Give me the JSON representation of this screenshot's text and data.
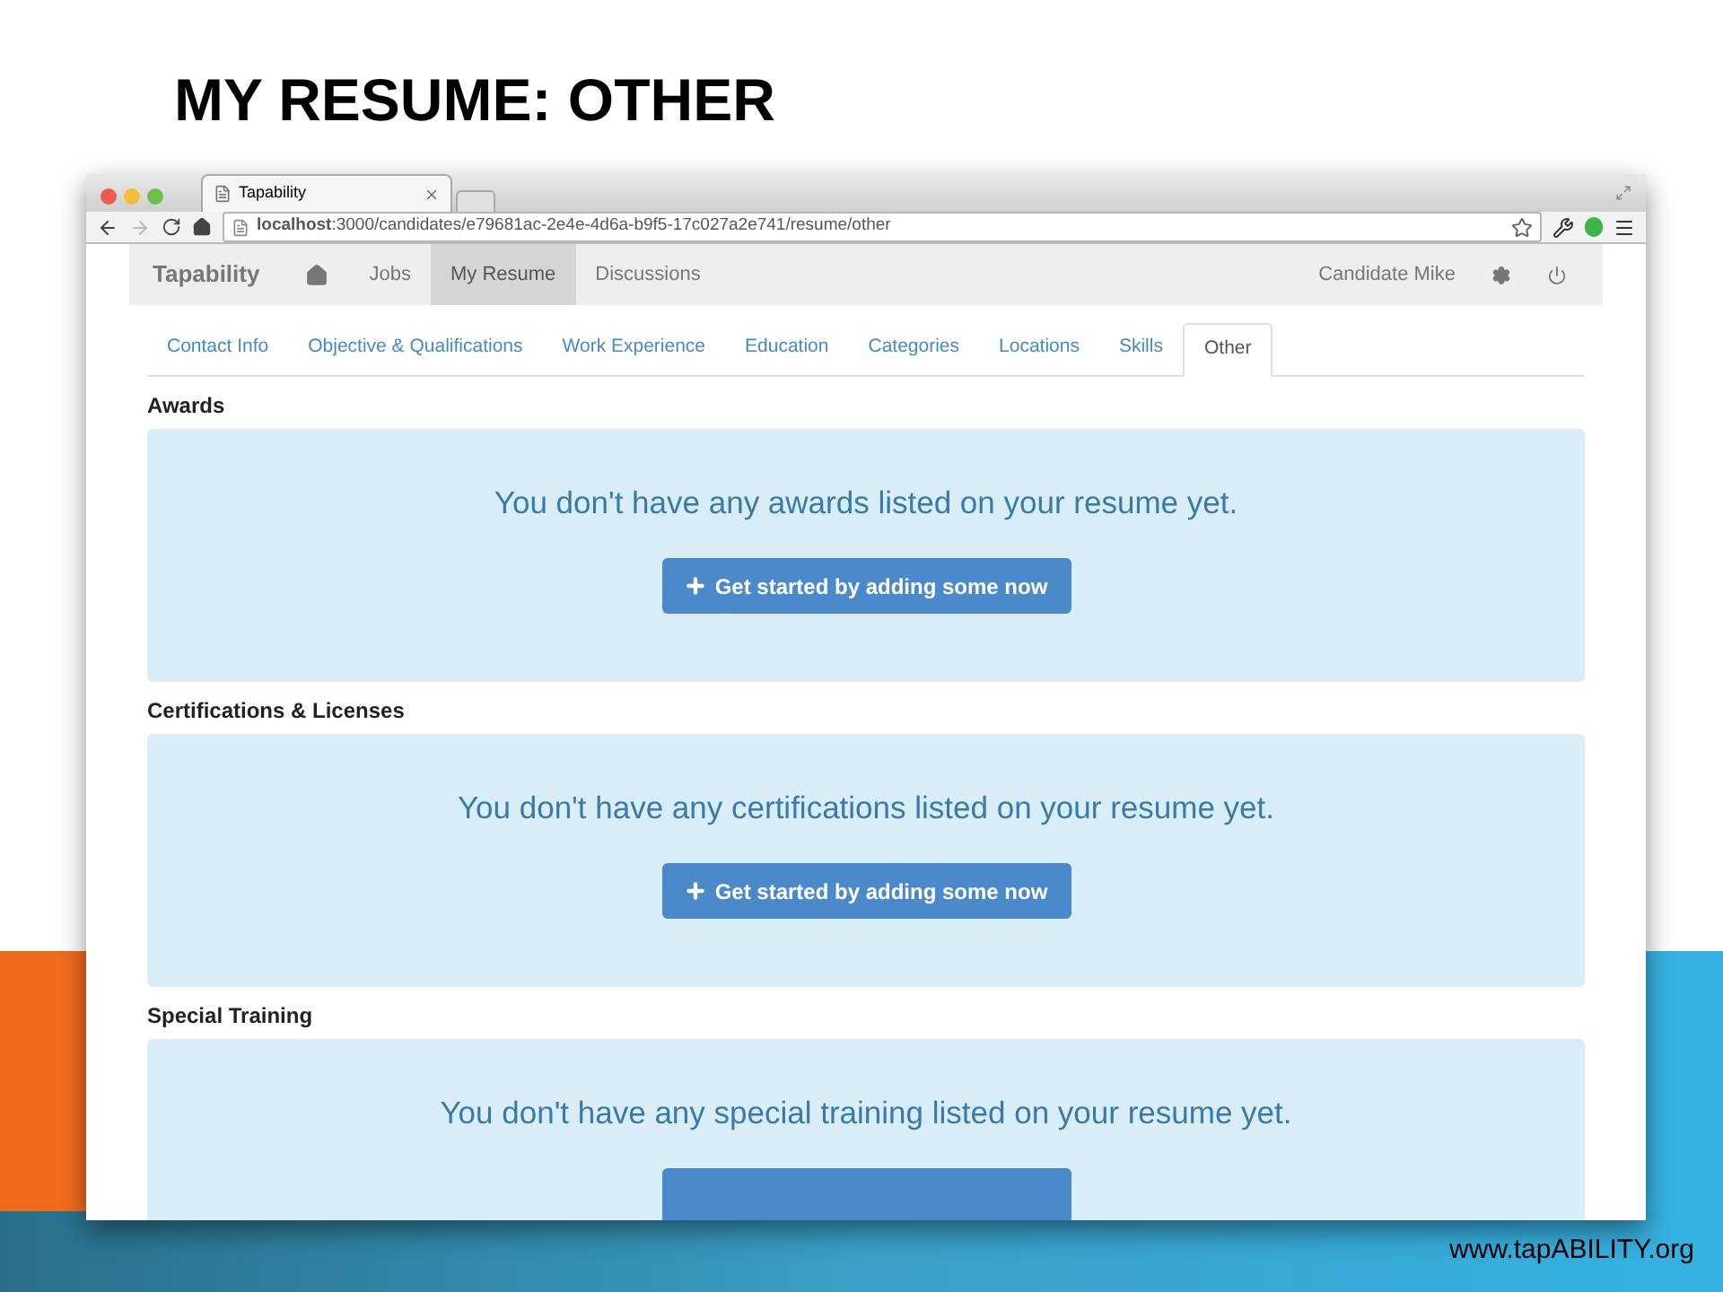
{
  "slide_title": "MY RESUME: OTHER",
  "browser": {
    "tab_title": "Tapability",
    "url": "**localhost**:3000/candidates/e79681ac-2e4e-4d6a-b9f5-17c027a2e741/resume/other"
  },
  "navbar": {
    "brand": "Tapability",
    "items": [
      {
        "kind": "home",
        "selected": false
      },
      {
        "kind": "link",
        "label": "Jobs",
        "selected": false
      },
      {
        "kind": "link",
        "label": "My Resume",
        "selected": true
      },
      {
        "kind": "link",
        "label": "Discussions",
        "selected": false
      }
    ],
    "user": "Candidate Mike"
  },
  "tabs": [
    {
      "label": "Contact Info",
      "selected": false
    },
    {
      "label": "Objective & Qualifications",
      "selected": false
    },
    {
      "label": "Work Experience",
      "selected": false
    },
    {
      "label": "Education",
      "selected": false
    },
    {
      "label": "Categories",
      "selected": false
    },
    {
      "label": "Locations",
      "selected": false
    },
    {
      "label": "Skills",
      "selected": false
    },
    {
      "label": "Other",
      "selected": true
    }
  ],
  "sections": [
    {
      "heading": "Awards",
      "message": "You don't have any awards listed on your resume yet.",
      "button": "Get started by adding some now"
    },
    {
      "heading": "Certifications & Licenses",
      "message": "You don't have any certifications listed on your resume yet.",
      "button": "Get started by adding some now"
    },
    {
      "heading": "Special Training",
      "message": "You don't have any special training listed on your resume yet.",
      "button_cut_off": true
    }
  ],
  "footer": "www.tapABILITY.org"
}
